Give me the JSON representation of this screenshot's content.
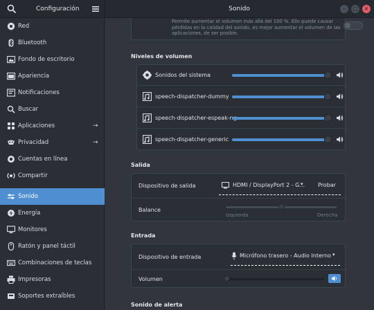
{
  "header": {
    "left_title": "Configuración",
    "center_title": "Sonido"
  },
  "sidebar": {
    "items": [
      {
        "label": "Red",
        "icon": "network-icon",
        "chevron": ""
      },
      {
        "label": "Bluetooth",
        "icon": "bluetooth-icon",
        "chevron": ""
      },
      {
        "label": "Fondo de escritorio",
        "icon": "wallpaper-icon",
        "chevron": ""
      },
      {
        "label": "Apariencia",
        "icon": "appearance-icon",
        "chevron": ""
      },
      {
        "label": "Notificaciones",
        "icon": "bell-icon",
        "chevron": ""
      },
      {
        "label": "Buscar",
        "icon": "search-icon",
        "chevron": ""
      },
      {
        "label": "Aplicaciones",
        "icon": "apps-icon",
        "chevron": "→"
      },
      {
        "label": "Privacidad",
        "icon": "privacy-icon",
        "chevron": "→"
      },
      {
        "label": "Cuentas en línea",
        "icon": "online-accounts-icon",
        "chevron": ""
      },
      {
        "label": "Compartir",
        "icon": "share-icon",
        "chevron": ""
      },
      {
        "label": "Sonido",
        "icon": "sound-icon",
        "chevron": "",
        "active": true
      },
      {
        "label": "Energía",
        "icon": "power-icon",
        "chevron": ""
      },
      {
        "label": "Monitores",
        "icon": "display-icon",
        "chevron": ""
      },
      {
        "label": "Ratón y panel táctil",
        "icon": "mouse-icon",
        "chevron": ""
      },
      {
        "label": "Combinaciones de teclas",
        "icon": "keyboard-icon",
        "chevron": ""
      },
      {
        "label": "Impresoras",
        "icon": "printer-icon",
        "chevron": ""
      },
      {
        "label": "Soportes extraíbles",
        "icon": "media-icon",
        "chevron": ""
      }
    ]
  },
  "overamp": {
    "note": "Permite aumentar el volumen más allá del 100 %. Ello puede causar pérdidas en la calidad del sonido, es mejor aumentar el volumen de las aplicaciones, de ser posible.",
    "enabled": false
  },
  "volume_levels": {
    "title": "Niveles de volumen",
    "rows": [
      {
        "label": "Sonidos del sistema",
        "icon": "gear-icon",
        "level": 1.0
      },
      {
        "label": "speech-dispatcher-dummy",
        "icon": "app-icon",
        "level": 1.0
      },
      {
        "label": "speech-dispatcher-espeak-ng",
        "icon": "app-icon",
        "level": 1.0
      },
      {
        "label": "speech-dispatcher-generic",
        "icon": "app-icon",
        "level": 1.0
      }
    ]
  },
  "output": {
    "title": "Salida",
    "device_label": "Dispositivo de salida",
    "device_value": "HDMI / DisplayPort 2 - G...",
    "test_button": "Probar",
    "balance_label": "Balance",
    "balance_left": "Izquierda",
    "balance_right": "Derecha",
    "balance_value": 0.5
  },
  "input": {
    "title": "Entrada",
    "device_label": "Dispositivo de entrada",
    "device_value": "Micrófono trasero - Audio Interno",
    "volume_label": "Volumen",
    "volume_level": 0.0
  },
  "alert": {
    "title": "Sonido de alerta"
  },
  "colors": {
    "accent": "#4f8fd1",
    "close": "#e25c68"
  }
}
